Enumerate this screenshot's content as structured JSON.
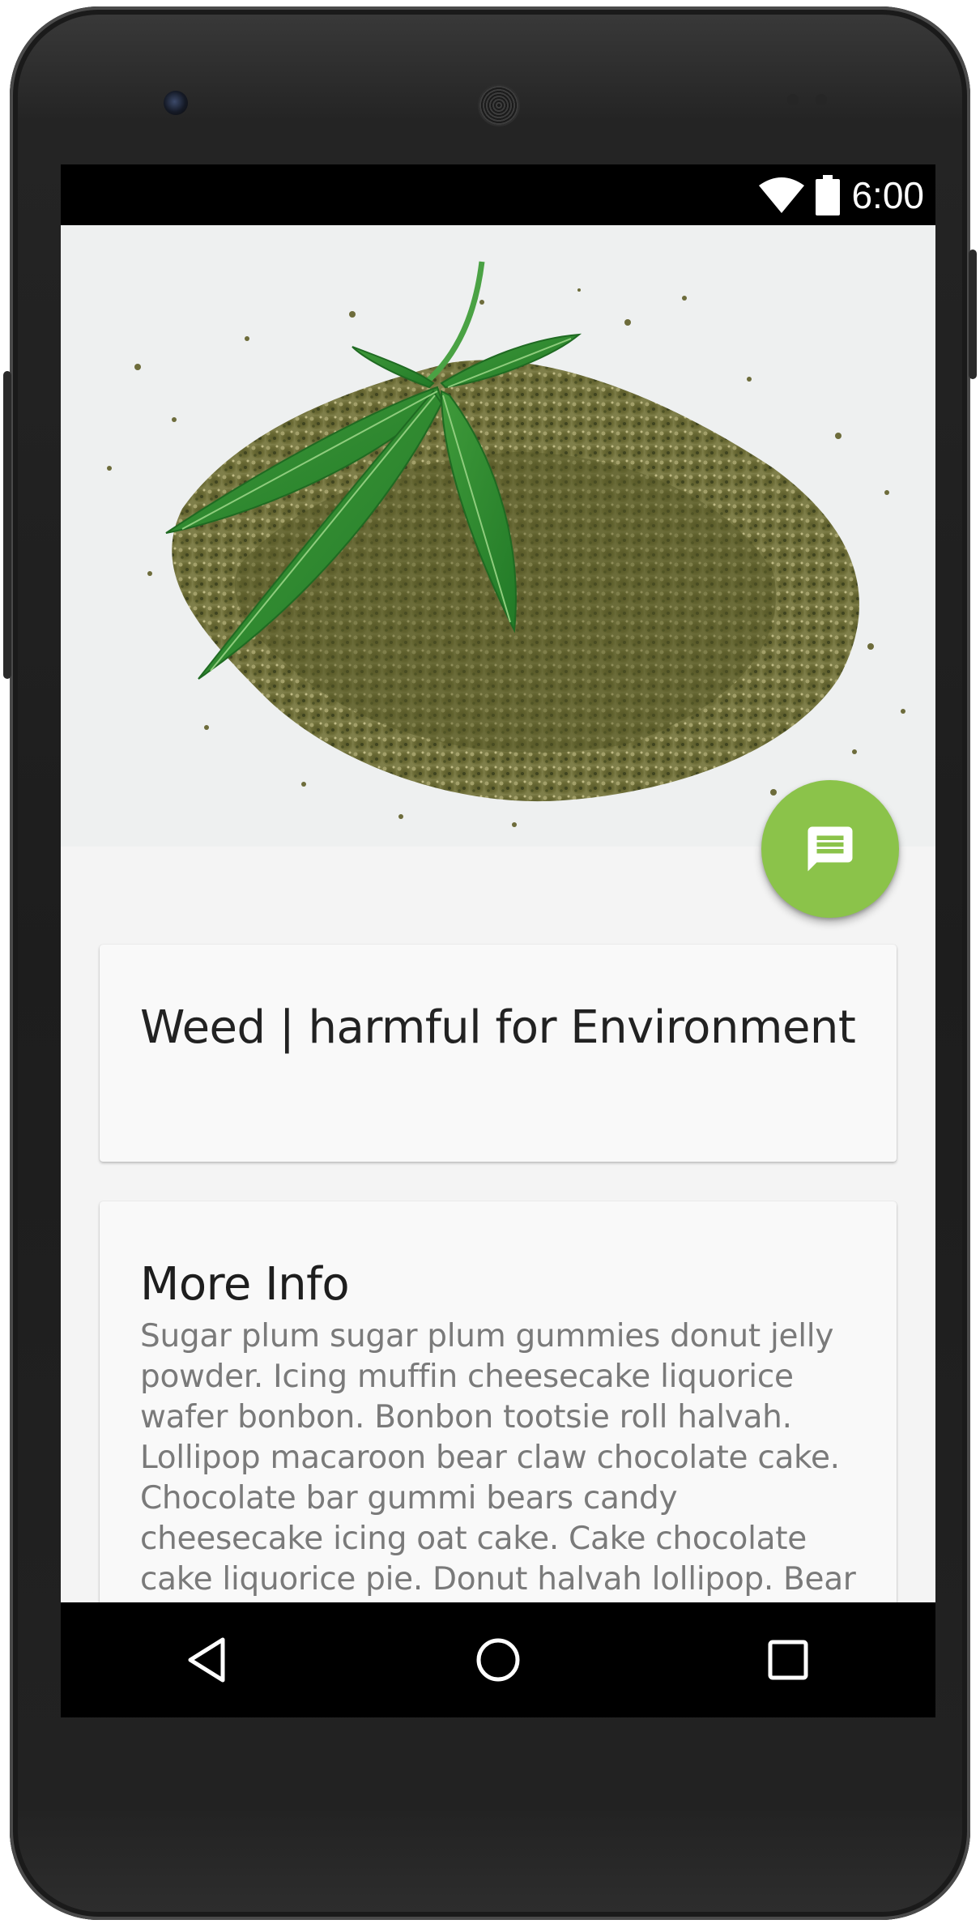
{
  "status_bar": {
    "time": "6:00",
    "icons": [
      "wifi-icon",
      "battery-icon"
    ]
  },
  "hero": {
    "image": "cannabis-leaf-and-ground-herb-image"
  },
  "fab": {
    "icon": "message-icon",
    "color": "#8bc34a"
  },
  "title_card": {
    "title": "Weed | harmful for Environment"
  },
  "info_card": {
    "heading": "More Info",
    "body": "Sugar plum sugar plum gummies donut jelly powder. Icing muffin cheesecake liquorice wafer bonbon. Bonbon tootsie roll halvah. Lollipop macaroon bear claw chocolate cake. Chocolate bar gummi bears candy cheesecake icing oat cake. Cake chocolate cake liquorice pie. Donut halvah lollipop. Bear claw lollipop"
  },
  "nav_bar": {
    "buttons": [
      "back-icon",
      "home-icon",
      "recents-icon"
    ]
  },
  "colors": {
    "accent": "#8bc34a",
    "background": "#f4f4f4",
    "card": "#f9f9f9",
    "bars": "#000000"
  }
}
